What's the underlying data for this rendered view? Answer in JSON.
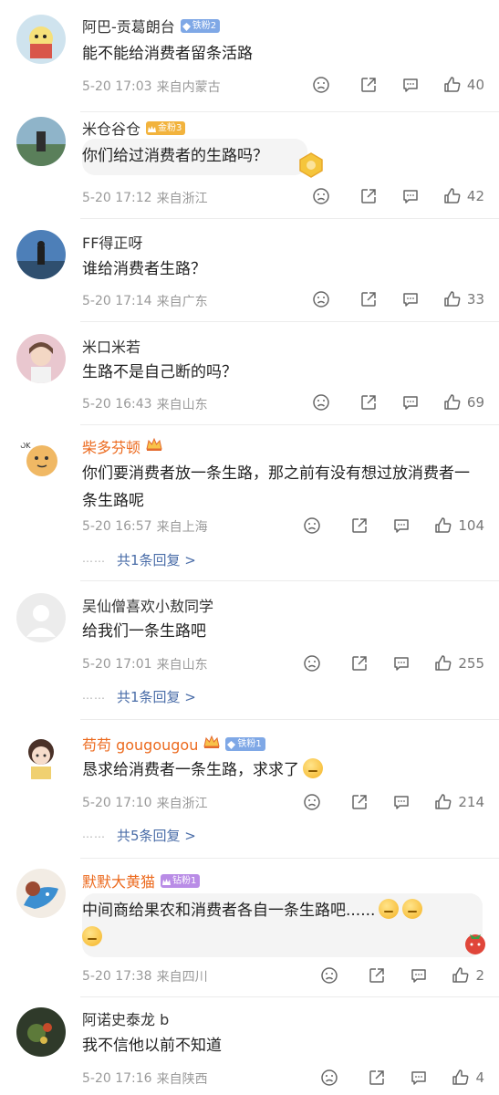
{
  "comments": [
    {
      "name": "阿巴-贡葛朗台",
      "name_color": "#333333",
      "badge": {
        "type": "iron",
        "label": "铁粉2"
      },
      "text": "能不能给消费者留条活路",
      "date": "5-20 17:03",
      "location": "来自内蒙古",
      "likes": "40"
    },
    {
      "name": "米仓谷仓",
      "name_color": "#333333",
      "badge": {
        "type": "gold",
        "label": "金粉3"
      },
      "text": "你们给过消费者的生路吗？",
      "date": "5-20 17:12",
      "location": "来自浙江",
      "likes": "42"
    },
    {
      "name": "FF得正呀",
      "name_color": "#333333",
      "text": "谁给消费者生路？",
      "date": "5-20 17:14",
      "location": "来自广东",
      "likes": "33"
    },
    {
      "name": "米口米若",
      "name_color": "#333333",
      "text": "生路不是自己断的吗？",
      "date": "5-20 16:43",
      "location": "来自山东",
      "likes": "69"
    },
    {
      "name": "柴多芬顿",
      "name_color": "#ec6a1e",
      "text": "你们要消费者放一条生路，那之前有没有想过放消费者一条生路呢",
      "date": "5-20 16:57",
      "location": "来自上海",
      "likes": "104",
      "replies": "共1条回复 >"
    },
    {
      "name": "吴仙僧喜欢小敖同学",
      "name_color": "#333333",
      "text": "给我们一条生路吧",
      "date": "5-20 17:01",
      "location": "来自山东",
      "likes": "255",
      "replies": "共1条回复 >"
    },
    {
      "name": "苟苟 gougougou",
      "name_color": "#ec6a1e",
      "badge": {
        "type": "iron",
        "label": "铁粉1"
      },
      "text": "恳求给消费者一条生路，求求了",
      "date": "5-20 17:10",
      "location": "来自浙江",
      "likes": "214",
      "replies": "共5条回复 >"
    },
    {
      "name": "默默大黄猫",
      "name_color": "#ec6a1e",
      "badge": {
        "type": "diamond",
        "label": "钻粉1"
      },
      "text": "中间商给果农和消费者各自一条生路吧......",
      "date": "5-20 17:38",
      "location": "来自四川",
      "likes": "2"
    },
    {
      "name": "阿诺史泰龙 b",
      "name_color": "#333333",
      "text": "我不信他以前不知道",
      "date": "5-20 17:16",
      "location": "来自陕西",
      "likes": "4"
    }
  ],
  "reply_dots": "⋯⋯"
}
